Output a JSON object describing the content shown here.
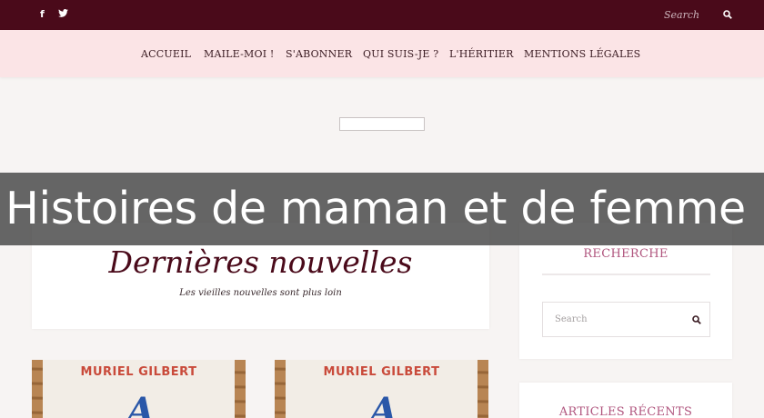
{
  "topbar": {
    "social": [
      {
        "name": "facebook-icon",
        "glyph": "f"
      },
      {
        "name": "twitter-icon",
        "glyph": ""
      }
    ],
    "search": {
      "placeholder": "Search",
      "icon": "search-icon"
    }
  },
  "nav": {
    "items": [
      {
        "label": "ACCUEIL"
      },
      {
        "label": "MAILE-MOI !"
      },
      {
        "label": "S'ABONNER"
      },
      {
        "label": "QUI SUIS-JE ?"
      },
      {
        "label": "L'HÉRITIER"
      },
      {
        "label": "MENTIONS LÉGALES"
      }
    ]
  },
  "overlay": {
    "title": "Histoires de maman et de femme"
  },
  "news": {
    "title": "Dernières nouvelles",
    "subtitle": "Les vieilles nouvelles sont plus loin"
  },
  "sidebar": {
    "search_widget": {
      "title": "RECHERCHE",
      "placeholder": "Search",
      "icon": "search-icon"
    },
    "recent_widget": {
      "title": "ARTICLES RÉCENTS"
    }
  },
  "posts": [
    {
      "author": "MURIEL GILBERT",
      "cover_letter": "A"
    },
    {
      "author": "MURIEL GILBERT",
      "cover_letter": "A"
    }
  ],
  "colors": {
    "topbar": "#4a0a1a",
    "navbar": "#fbe4e6",
    "accent": "#b0557e",
    "title": "#4a0a1a"
  }
}
